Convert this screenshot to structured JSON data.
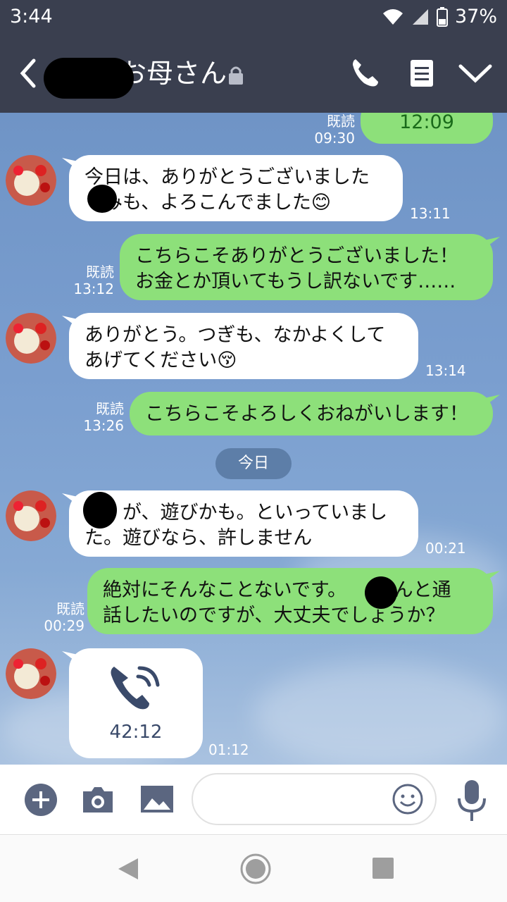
{
  "status": {
    "time": "3:44",
    "battery": "37%"
  },
  "header": {
    "title": "お母さん"
  },
  "chat": {
    "top_read": "既読",
    "top_read_time": "09:30",
    "top_bubble": "12:09",
    "messages": [
      {
        "lines": [
          "今日は、ありがとうございました",
          "　みも、よろこんでました😊"
        ],
        "time": "13:11"
      },
      {
        "lines": [
          "こちらこそありがとうございました！",
          "お金とか頂いてもうし訳ないです……"
        ],
        "read": "既読",
        "time": "13:12"
      },
      {
        "lines": [
          "ありがとう。つぎも、なかよくして",
          "あげてください😚"
        ],
        "time": "13:14"
      },
      {
        "lines": [
          "こちらこそよろしくおねがいします！"
        ],
        "read": "既読",
        "time": "13:26"
      },
      {
        "lines": [
          "　　が、遊びかも。といっていまし",
          "た。遊びなら、許しません"
        ],
        "time": "00:21"
      },
      {
        "lines": [
          "絶対にそんなことないです。　　さんと通",
          "話したいのですが、大丈夫でしょうか？"
        ],
        "read": "既読",
        "time": "00:29"
      }
    ],
    "date_divider": "今日",
    "call": {
      "duration": "42:12",
      "time": "01:12"
    }
  },
  "input": {
    "placeholder": ""
  }
}
